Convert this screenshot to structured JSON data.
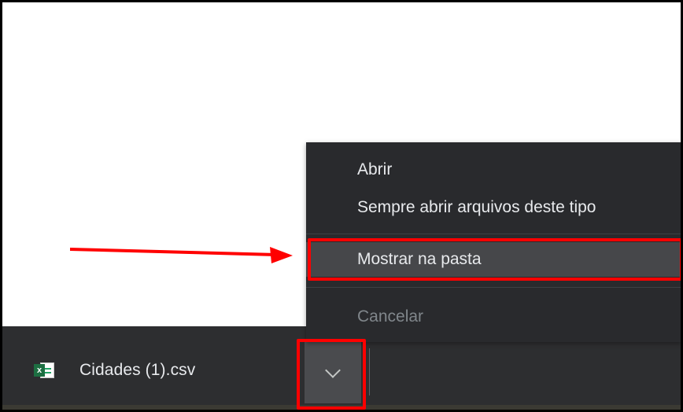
{
  "context_menu": {
    "items": [
      {
        "label": "Abrir",
        "enabled": true,
        "highlighted": false
      },
      {
        "label": "Sempre abrir arquivos deste tipo",
        "enabled": true,
        "highlighted": false
      },
      {
        "label": "Mostrar na pasta",
        "enabled": true,
        "highlighted": true
      },
      {
        "label": "Cancelar",
        "enabled": false,
        "highlighted": false
      }
    ]
  },
  "download_bar": {
    "file_name": "Cidades (1).csv",
    "file_icon": "excel-icon",
    "menu_button_icon": "chevron-down-icon"
  },
  "annotations": {
    "highlight_color": "#ff0000",
    "arrow_icon": "red-arrow"
  },
  "colors": {
    "menu_bg": "#292a2d",
    "bar_bg": "#2d2e30",
    "hover_bg": "#46474a",
    "text": "#e8eaed",
    "disabled_text": "#80868b"
  }
}
